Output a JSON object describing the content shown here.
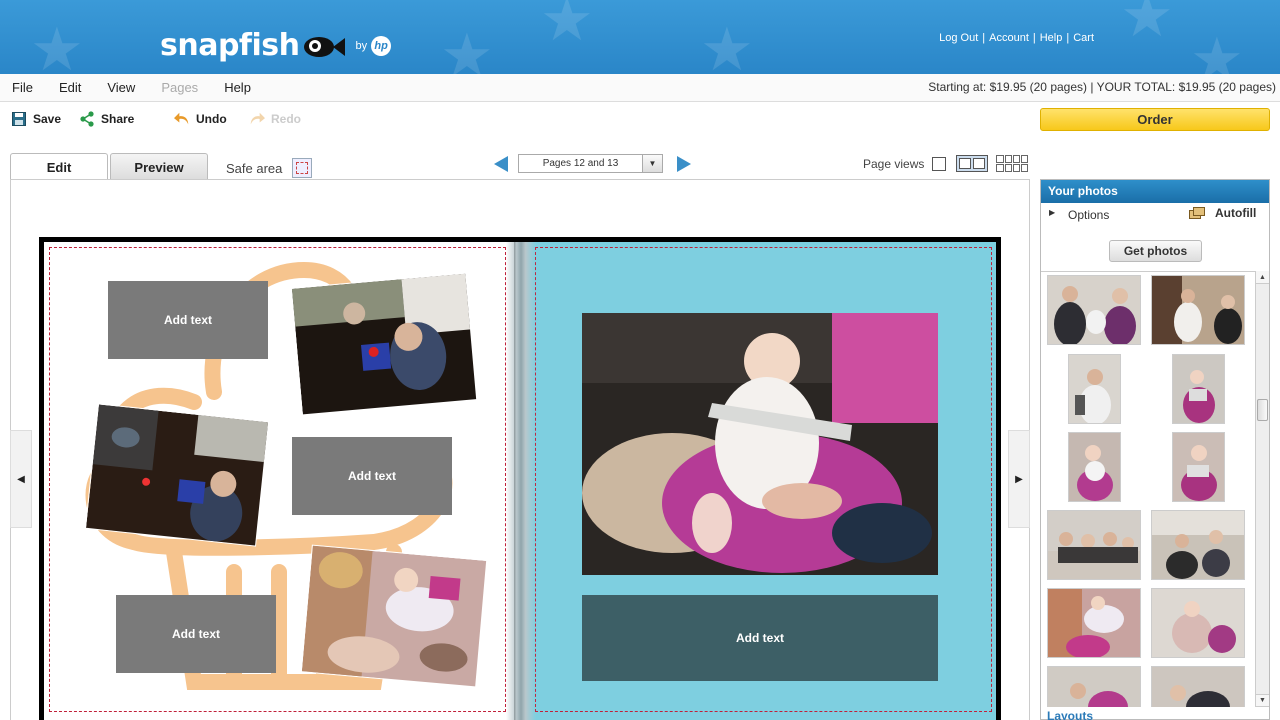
{
  "header": {
    "logo_text": "snapfish",
    "logo_by": "by",
    "logo_hp": "hp",
    "links": [
      "Log Out",
      "Account",
      "Help",
      "Cart"
    ]
  },
  "menu": {
    "items": [
      "File",
      "Edit",
      "View",
      "Pages",
      "Help"
    ],
    "disabled": [
      "Pages"
    ],
    "total_text": "Starting at: $19.95 (20 pages)  |  YOUR TOTAL: $19.95 (20 pages)"
  },
  "toolbar": {
    "save_label": "Save",
    "share_label": "Share",
    "undo_label": "Undo",
    "redo_label": "Redo",
    "order_label": "Order"
  },
  "editor": {
    "tabs": [
      "Edit",
      "Preview"
    ],
    "active_tab": "Edit",
    "safe_area_label": "Safe area",
    "page_selector": "Pages 12 and 13",
    "page_views_label": "Page views"
  },
  "spread": {
    "left_textboxes": [
      "Add text",
      "Add text",
      "Add text"
    ],
    "right_textbox": "Add text",
    "left_bg_color": "#ffffff",
    "right_bg_color": "#7ecfe0",
    "safe_border_color": "#c0203a"
  },
  "photos_panel": {
    "title": "Your photos",
    "options_label": "Options",
    "autofill_label": "Autofill",
    "get_photos_label": "Get photos",
    "thumbnail_count": 12,
    "layouts_label": "Layouts"
  },
  "colors": {
    "header_blue": "#2a86c8",
    "order_yellow": "#f7c81a",
    "accent_blue": "#3a8fc8"
  }
}
